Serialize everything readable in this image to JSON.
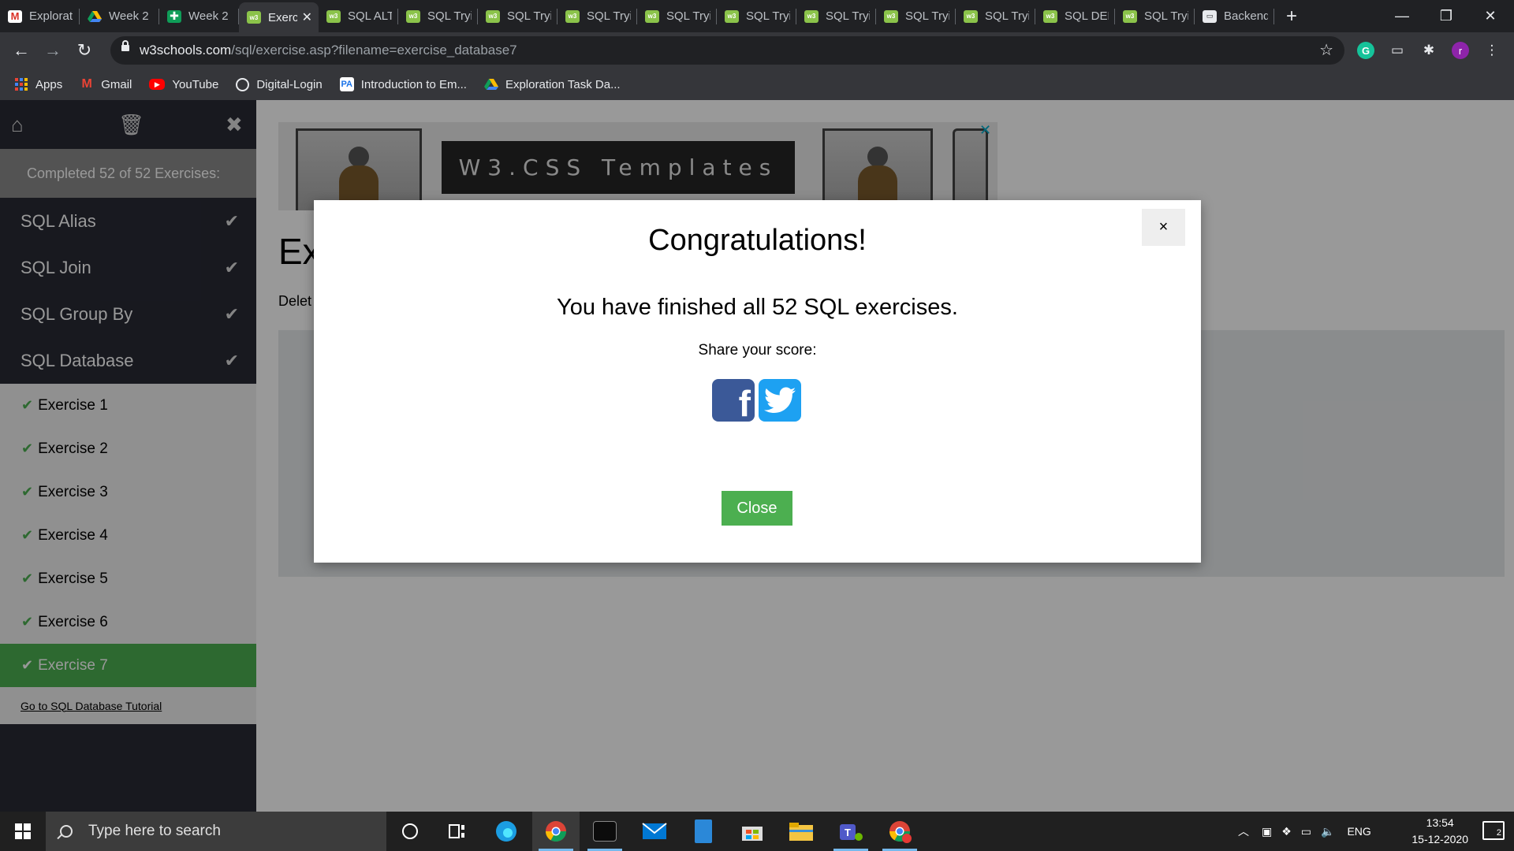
{
  "browser": {
    "tabs": [
      {
        "label": "Exploration",
        "icon": "gmail-icon"
      },
      {
        "label": "Week 2",
        "icon": "google-drive-icon"
      },
      {
        "label": "Week 2",
        "icon": "google-sheets-icon"
      },
      {
        "label": "Exercise",
        "icon": "w3schools-icon",
        "active": true
      },
      {
        "label": "SQL ALTER",
        "icon": "w3schools-icon"
      },
      {
        "label": "SQL Tryit",
        "icon": "w3schools-icon"
      },
      {
        "label": "SQL Tryit",
        "icon": "w3schools-icon"
      },
      {
        "label": "SQL Tryit",
        "icon": "w3schools-icon"
      },
      {
        "label": "SQL Tryit",
        "icon": "w3schools-icon"
      },
      {
        "label": "SQL Tryit",
        "icon": "w3schools-icon"
      },
      {
        "label": "SQL Tryit",
        "icon": "w3schools-icon"
      },
      {
        "label": "SQL Tryit",
        "icon": "w3schools-icon"
      },
      {
        "label": "SQL Tryit",
        "icon": "w3schools-icon"
      },
      {
        "label": "SQL DEFAULT",
        "icon": "w3schools-icon"
      },
      {
        "label": "SQL Tryit",
        "icon": "w3schools-icon"
      },
      {
        "label": "Backend",
        "icon": "book-icon"
      }
    ],
    "url_host": "w3schools.com",
    "url_path": "/sql/exercise.asp?filename=exercise_database7",
    "profile_initial": "r",
    "bookmarks": [
      {
        "label": "Apps",
        "icon": "apps-grid-icon"
      },
      {
        "label": "Gmail",
        "icon": "gmail-icon"
      },
      {
        "label": "YouTube",
        "icon": "youtube-icon"
      },
      {
        "label": "Digital-Login",
        "icon": "globe-icon"
      },
      {
        "label": "Introduction to Em...",
        "icon": "power-automate-icon"
      },
      {
        "label": "Exploration Task Da...",
        "icon": "google-drive-icon"
      }
    ]
  },
  "sidebar": {
    "completed": "Completed 52 of 52 Exercises:",
    "categories": [
      {
        "label": "SQL Alias"
      },
      {
        "label": "SQL Join"
      },
      {
        "label": "SQL Group By"
      },
      {
        "label": "SQL Database"
      }
    ],
    "exercises": [
      {
        "label": "Exercise 1"
      },
      {
        "label": "Exercise 2"
      },
      {
        "label": "Exercise 3"
      },
      {
        "label": "Exercise 4"
      },
      {
        "label": "Exercise 5"
      },
      {
        "label": "Exercise 6"
      },
      {
        "label": "Exercise 7",
        "active": true
      }
    ],
    "tutorial_link": "Go to SQL Database Tutorial"
  },
  "main": {
    "ad_text": "W3.CSS Templates",
    "heading_partial": "Ex",
    "subtext_partial": "Delet"
  },
  "modal": {
    "title": "Congratulations!",
    "message": "You have finished all 52 SQL exercises.",
    "share_label": "Share your score:",
    "close_label": "Close",
    "close_x": "×"
  },
  "taskbar": {
    "search_placeholder": "Type here to search",
    "language": "ENG",
    "time": "13:54",
    "date": "15-12-2020",
    "notification_count": "2"
  },
  "colors": {
    "w3_green": "#4CAF50",
    "sidebar_dark": "#282A35",
    "facebook_blue": "#3b5998",
    "twitter_blue": "#1da1f2"
  }
}
